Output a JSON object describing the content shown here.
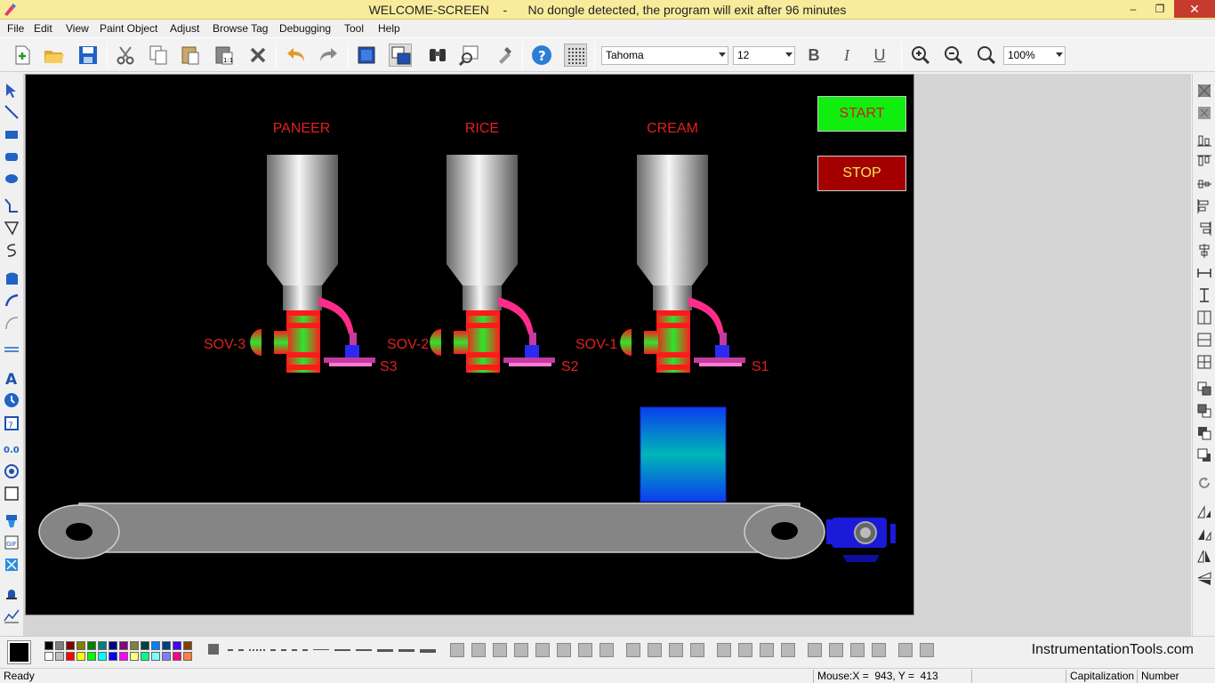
{
  "window": {
    "title": "WELCOME-SCREEN    -      No dongle detected, the program will exit after 96 minutes",
    "min_glyph": "–",
    "max_glyph": "❐",
    "close_glyph": "✕"
  },
  "menu": [
    "File",
    "Edit",
    "View",
    "Paint Object",
    "Adjust",
    "Browse Tag",
    "Debugging",
    "Tool",
    "Help"
  ],
  "toolbar": {
    "font_name": "Tahoma",
    "font_size": "12",
    "zoom": "100%",
    "bold": "B",
    "italic": "I",
    "underline": "U"
  },
  "hmi": {
    "hoppers": [
      {
        "product": "PANEER",
        "valve": "SOV-3",
        "sensor": "S3"
      },
      {
        "product": "RICE",
        "valve": "SOV-2",
        "sensor": "S2"
      },
      {
        "product": "CREAM",
        "valve": "SOV-1",
        "sensor": "S1"
      }
    ],
    "start_label": "START",
    "stop_label": "STOP",
    "colors": {
      "label_red": "#e0201e",
      "start_green": "#10ee10",
      "stop_red": "#a50000",
      "valve_red": "#ff1a1a",
      "valve_green": "#2ee52e",
      "pipe_pink": "#ff2d8a",
      "box_blue": "#0a3ef0",
      "motor_blue": "#1a1ad8",
      "conveyor_gray": "#858585"
    }
  },
  "bottom": {
    "watermark": "InstrumentationTools.com"
  },
  "status": {
    "ready": "Ready",
    "mouse": "Mouse:X =  943, Y =  413",
    "caps": "Capitalization",
    "num": "Number"
  }
}
